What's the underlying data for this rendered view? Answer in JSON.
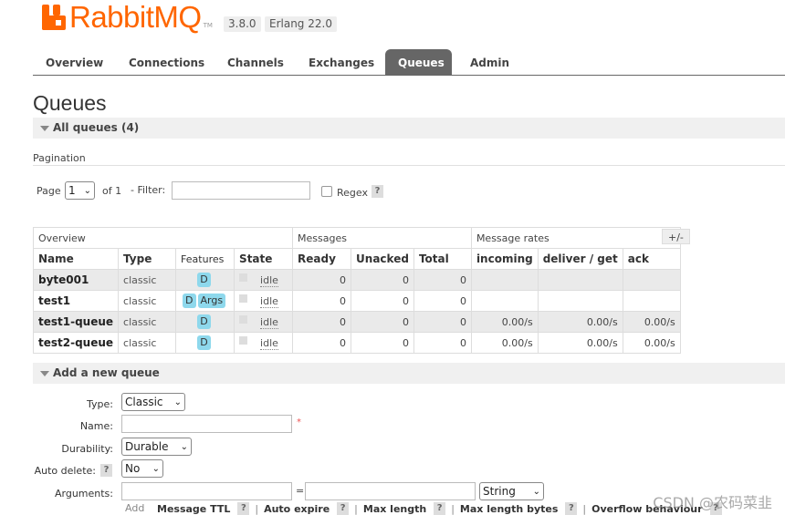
{
  "header": {
    "logo_text": "RabbitMQ",
    "logo_tm": "TM",
    "version": "3.8.0",
    "erlang": "Erlang 22.0"
  },
  "tabs": [
    {
      "label": "Overview"
    },
    {
      "label": "Connections"
    },
    {
      "label": "Channels"
    },
    {
      "label": "Exchanges"
    },
    {
      "label": "Queues",
      "active": true
    },
    {
      "label": "Admin"
    }
  ],
  "page_title": "Queues",
  "all_queues": {
    "label": "All queues (4)"
  },
  "pagination": {
    "section_label": "Pagination",
    "page_label": "Page",
    "page_value": "1",
    "of_label": "of 1",
    "filter_label": "- Filter:",
    "filter_value": "",
    "regex_label": "Regex",
    "help": "?"
  },
  "table": {
    "group_headers": {
      "overview": "Overview",
      "messages": "Messages",
      "rates": "Message rates"
    },
    "columns": [
      "Name",
      "Type",
      "Features",
      "State",
      "Ready",
      "Unacked",
      "Total",
      "incoming",
      "deliver / get",
      "ack"
    ],
    "toggle_label": "+/-",
    "rows": [
      {
        "name": "byte001",
        "type": "classic",
        "features": [
          "D"
        ],
        "state": "idle",
        "ready": "0",
        "unacked": "0",
        "total": "0",
        "incoming": "",
        "deliver": "",
        "ack": ""
      },
      {
        "name": "test1",
        "type": "classic",
        "features": [
          "D",
          "Args"
        ],
        "state": "idle",
        "ready": "0",
        "unacked": "0",
        "total": "0",
        "incoming": "",
        "deliver": "",
        "ack": ""
      },
      {
        "name": "test1-queue",
        "type": "classic",
        "features": [
          "D"
        ],
        "state": "idle",
        "ready": "0",
        "unacked": "0",
        "total": "0",
        "incoming": "0.00/s",
        "deliver": "0.00/s",
        "ack": "0.00/s"
      },
      {
        "name": "test2-queue",
        "type": "classic",
        "features": [
          "D"
        ],
        "state": "idle",
        "ready": "0",
        "unacked": "0",
        "total": "0",
        "incoming": "0.00/s",
        "deliver": "0.00/s",
        "ack": "0.00/s"
      }
    ]
  },
  "add_queue": {
    "label": "Add a new queue",
    "type_label": "Type:",
    "type_value": "Classic",
    "name_label": "Name:",
    "name_value": "",
    "required_mark": "*",
    "durability_label": "Durability:",
    "durability_value": "Durable",
    "auto_delete_label": "Auto delete:",
    "auto_delete_value": "No",
    "arguments_label": "Arguments:",
    "equals": "=",
    "arg_type_value": "String",
    "add_label": "Add",
    "arg_links": [
      "Message TTL",
      "Auto expire",
      "Max length",
      "Max length bytes",
      "Overflow behaviour"
    ],
    "help": "?",
    "sep": "|"
  },
  "watermark": "CSDN @农码菜韭",
  "colors": {
    "brand": "#ff6600",
    "tab_active": "#666666",
    "badge": "#8ed8ec"
  }
}
